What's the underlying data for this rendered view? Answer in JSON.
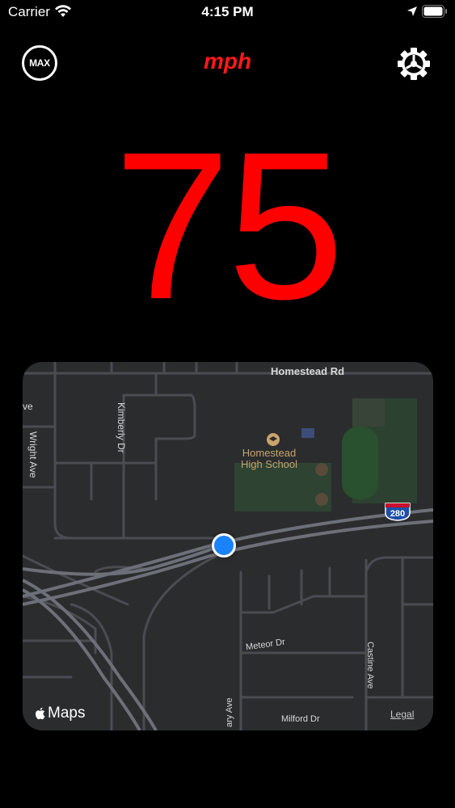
{
  "status_bar": {
    "carrier": "Carrier",
    "time": "4:15 PM"
  },
  "header": {
    "max_label": "MAX",
    "unit": "mph",
    "settings_icon": "gear-icon"
  },
  "speed": {
    "value": "75",
    "color": "#ff0000"
  },
  "map": {
    "labels": {
      "homestead_rd": "Homestead Rd",
      "ave_partial": "ve",
      "wright_ave": "Wright Ave",
      "kimberly_dr": "Kimberly Dr",
      "school_line1": "Homestead",
      "school_line2": "High School",
      "highway_shield": "280",
      "meteor_dr": "Meteor Dr",
      "castine_ave": "Castine Ave",
      "milford_dr": "Milford Dr",
      "ary_ave": "ary Ave"
    },
    "attribution": "Maps",
    "legal": "Legal",
    "user_location_color": "#1a82fb"
  }
}
